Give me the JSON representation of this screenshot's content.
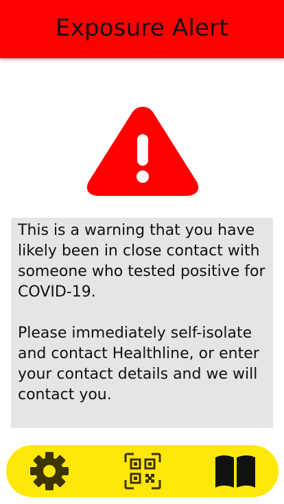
{
  "header": {
    "title": "Exposure Alert"
  },
  "alert": {
    "icon": "warning-triangle-icon"
  },
  "message": {
    "paragraph_1": "This is a warning that you have likely been in close contact with someone who tested positive for COVID-19.",
    "paragraph_2": "Please immediately self-isolate and contact Healthline, or enter your contact details and we will contact you."
  },
  "nav": {
    "items": [
      {
        "icon": "gear-icon"
      },
      {
        "icon": "qr-code-icon"
      },
      {
        "icon": "book-icon"
      }
    ]
  },
  "colors": {
    "header_bg": "#ff0000",
    "alert_red": "#ff0000",
    "message_bg": "#e5e5e5",
    "nav_bg": "#ffe70a",
    "nav_icon": "#3d3300"
  }
}
